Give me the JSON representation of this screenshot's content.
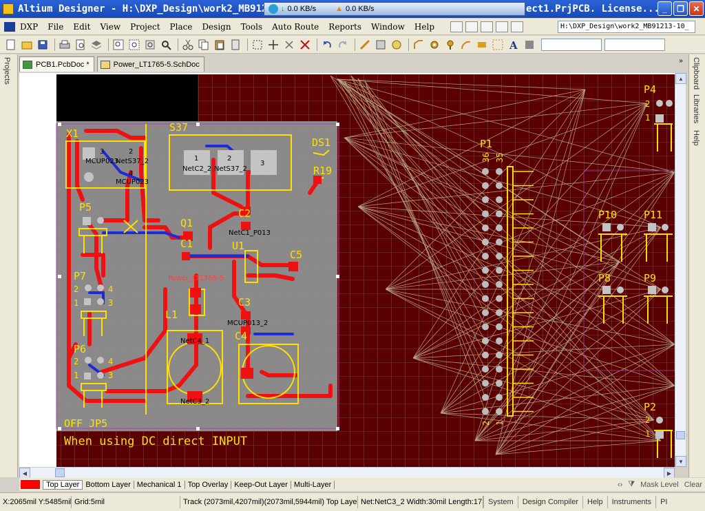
{
  "window": {
    "title": "Altium Designer - H:\\DXP_Design\\work2_MB91213",
    "title_suffix": "ect1.PrjPCB. License...",
    "net_upload": "0.0 KB/s",
    "net_download": "0.0 KB/s"
  },
  "menu": {
    "items": [
      "DXP",
      "File",
      "Edit",
      "View",
      "Project",
      "Place",
      "Design",
      "Tools",
      "Auto Route",
      "Reports",
      "Window",
      "Help"
    ],
    "path_combo": "H:\\DXP_Design\\work2_MB91213-10_"
  },
  "panels": {
    "left": "Projects",
    "right": [
      "Clipboard",
      "Libraries",
      "Help"
    ]
  },
  "documents": [
    {
      "label": "PCB1.PcbDoc *",
      "active": true
    },
    {
      "label": "Power_LT1765-5.SchDoc",
      "active": false
    }
  ],
  "pcb": {
    "components": [
      "X1",
      "S37",
      "DS1",
      "R19",
      "P5",
      "Q1",
      "C2",
      "C1",
      "U1",
      "C5",
      "P7",
      "C3",
      "L1",
      "C4",
      "P6",
      "P1",
      "P4",
      "P10",
      "P11",
      "P8",
      "P9",
      "P2"
    ],
    "room_label": "Power_LT1765-5",
    "board_text_1": "OFF JP5",
    "board_text_2": "When using DC direct INPUT",
    "net_labels": [
      "MCUP023",
      "NetS37_2",
      "MCUP023",
      "NetC2_2",
      "NetS37_2",
      "NetC1_P013",
      "MCUP013_2",
      "NetC4_1",
      "NetC3_2"
    ],
    "pad_numbers": [
      "1",
      "2",
      "3",
      "4",
      "36",
      "35"
    ]
  },
  "layers": {
    "active_color": "#ff0000",
    "tabs": [
      "Top Layer",
      "Bottom Layer",
      "Mechanical 1",
      "Top Overlay",
      "Keep-Out Layer",
      "Multi-Layer"
    ],
    "mask_level": "Mask Level",
    "clear": "Clear"
  },
  "status": {
    "coords": "X:2065mil Y:5485mil",
    "grid": "Grid:5mil",
    "track": "Track (2073mil,4207mil)(2073mil,5944mil)  Top Layer",
    "net_info": "Net:NetC3_2 Width:30mil Length:173",
    "buttons": [
      "System",
      "Design Compiler",
      "Help",
      "Instruments",
      "PI"
    ]
  }
}
